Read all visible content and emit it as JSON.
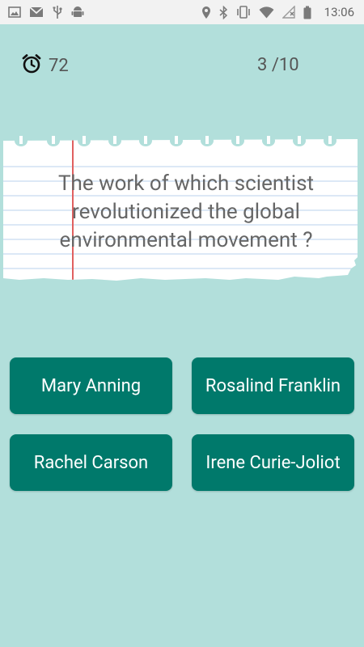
{
  "status_bar": {
    "time": "13:06",
    "icons": [
      "image-icon",
      "gmail-icon",
      "usb-icon",
      "android-icon",
      "location-icon",
      "bluetooth-icon",
      "vibrate-icon",
      "wifi-icon",
      "no-signal-icon",
      "battery-icon"
    ]
  },
  "quiz": {
    "timer_value": "72",
    "progress": "3 /10",
    "question": "The work of which scientist revolutionized the global environmental movement ?",
    "answers": [
      "Mary Anning",
      "Rosalind Franklin",
      "Rachel Carson",
      "Irene Curie-Joliot"
    ]
  },
  "colors": {
    "background": "#b2dfdb",
    "button": "#00796b",
    "button_text": "#ffffff",
    "paper": "#ffffff",
    "paper_line": "#a7c8ea",
    "margin_line": "#e06060"
  }
}
